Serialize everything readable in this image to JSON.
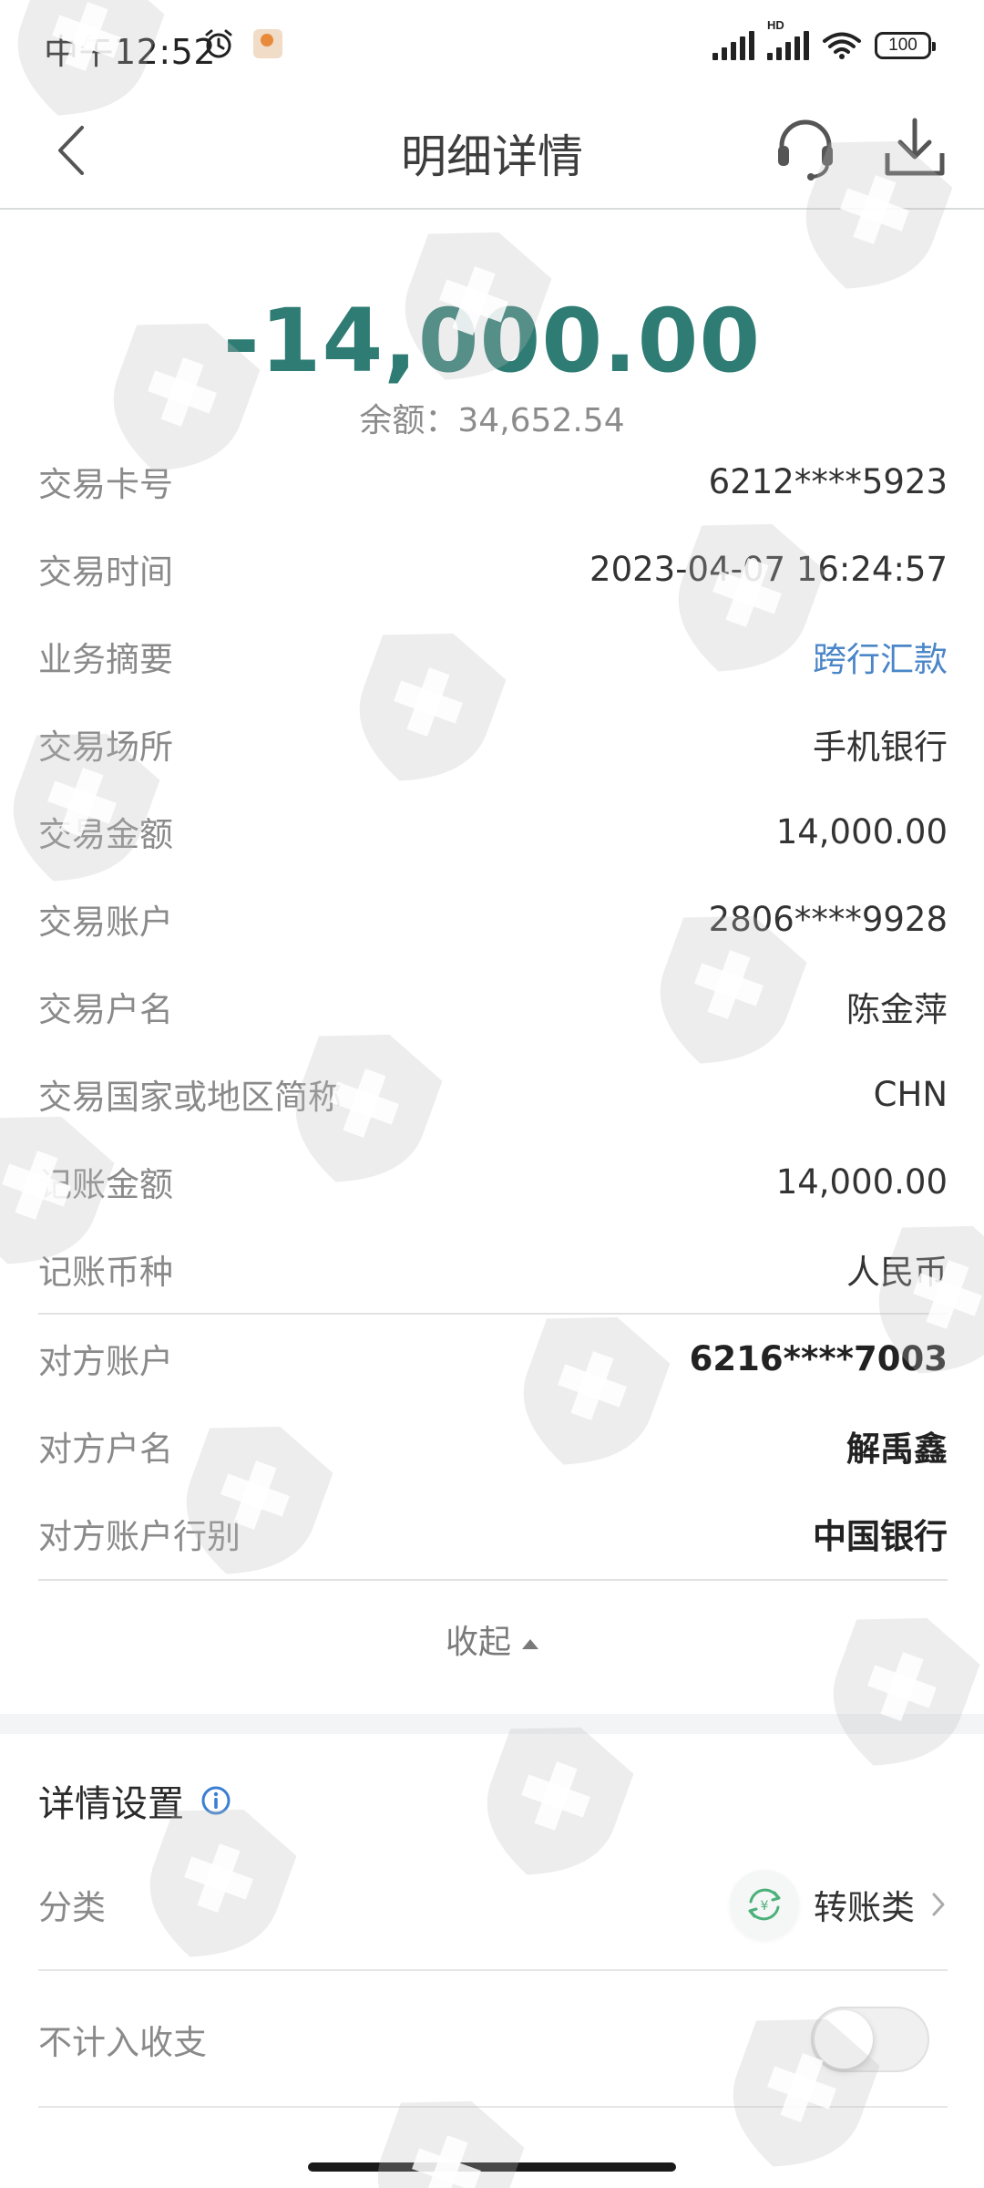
{
  "status_bar": {
    "time": "中午12:52",
    "hd": "HD",
    "battery": "100"
  },
  "header": {
    "title": "明细详情"
  },
  "summary": {
    "amount": "-14,000.00",
    "balance_label": "余额：",
    "balance": "34,652.54"
  },
  "details": [
    {
      "label": "交易卡号",
      "value": "6212****5923"
    },
    {
      "label": "交易时间",
      "value": "2023-04-07 16:24:57"
    },
    {
      "label": "业务摘要",
      "value": "跨行汇款"
    },
    {
      "label": "交易场所",
      "value": "手机银行"
    },
    {
      "label": "交易金额",
      "value": "14,000.00"
    },
    {
      "label": "交易账户",
      "value": "2806****9928"
    },
    {
      "label": "交易户名",
      "value": "陈金萍"
    },
    {
      "label": "交易国家或地区简称",
      "value": "CHN"
    },
    {
      "label": "记账金额",
      "value": "14,000.00"
    },
    {
      "label": "记账币种",
      "value": "人民币"
    }
  ],
  "counterparty": [
    {
      "label": "对方账户",
      "value": "6216****7003"
    },
    {
      "label": "对方户名",
      "value": "解禹鑫"
    },
    {
      "label": "对方账户行别",
      "value": "中国银行"
    }
  ],
  "collapse_label": "收起",
  "settings": {
    "title": "详情设置",
    "category_label": "分类",
    "category_value": "转账类",
    "exclude_label": "不计入收支",
    "exclude_on": false
  },
  "colors": {
    "accent": "#2e7c74",
    "link": "#4a86c8",
    "info": "#3b7fd1"
  }
}
